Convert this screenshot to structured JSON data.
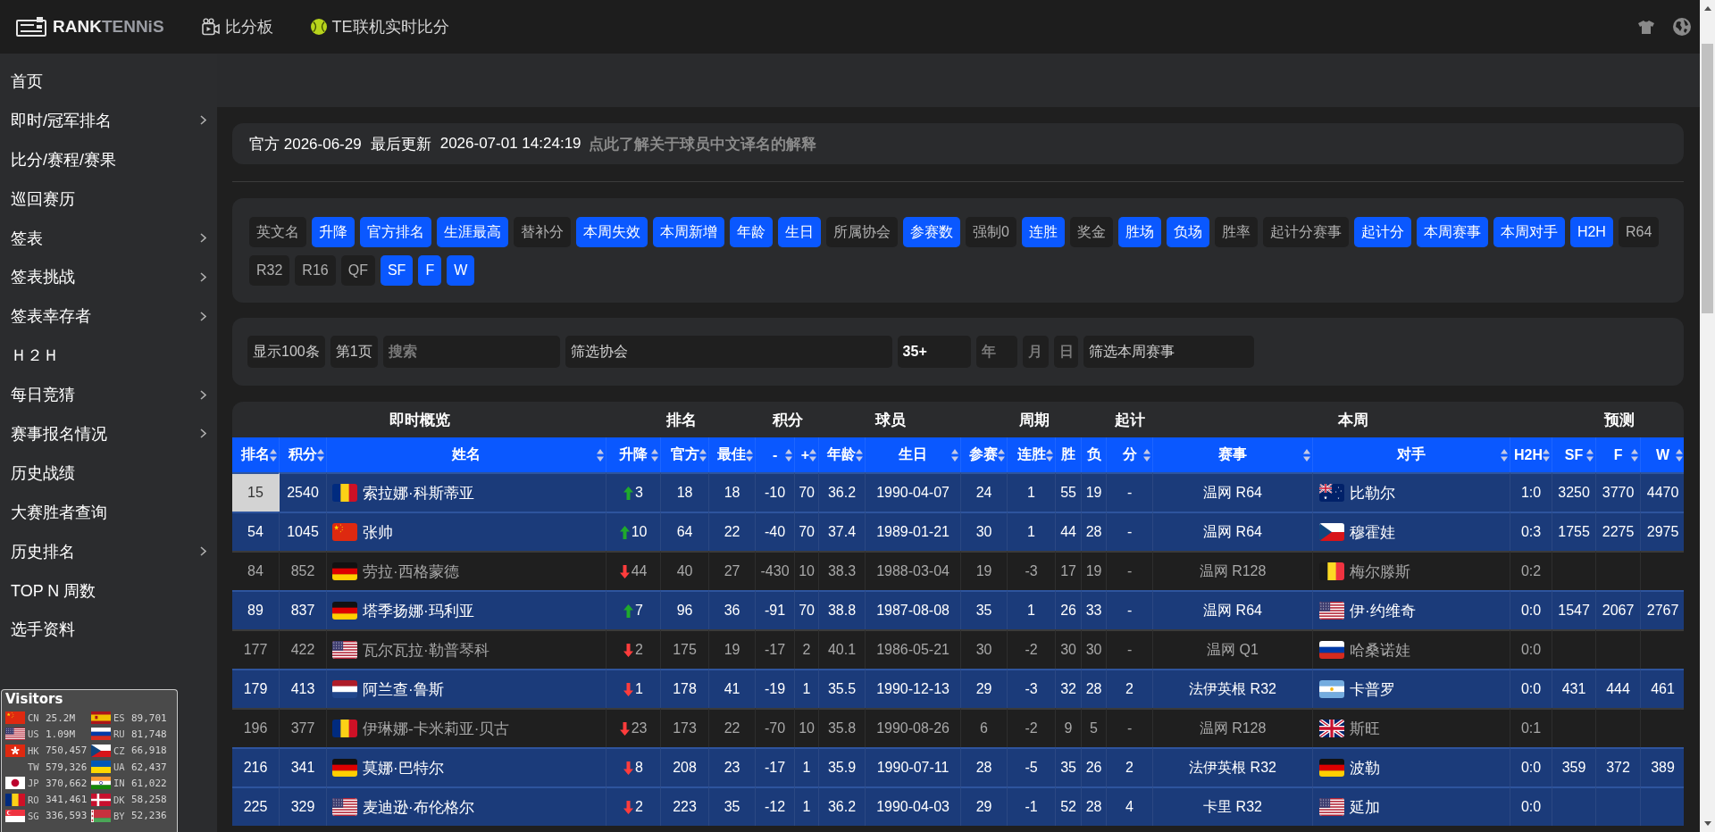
{
  "header": {
    "logo": {
      "strong": "RANK",
      "light": "TENNiS"
    },
    "nav": [
      {
        "kind": "video",
        "label": "比分板"
      },
      {
        "kind": "ball",
        "label": "TE联机实时比分"
      }
    ]
  },
  "sidebar": {
    "items": [
      {
        "label": "首页",
        "has_submenu": false
      },
      {
        "label": "即时/冠军排名",
        "has_submenu": true
      },
      {
        "label": "比分/赛程/赛果",
        "has_submenu": false
      },
      {
        "label": "巡回赛历",
        "has_submenu": false
      },
      {
        "label": "签表",
        "has_submenu": true
      },
      {
        "label": "签表挑战",
        "has_submenu": true
      },
      {
        "label": "签表幸存者",
        "has_submenu": true
      },
      {
        "label": "Ｈ２Ｈ",
        "has_submenu": false
      },
      {
        "label": "每日竞猜",
        "has_submenu": true
      },
      {
        "label": "赛事报名情况",
        "has_submenu": true
      },
      {
        "label": "历史战绩",
        "has_submenu": false
      },
      {
        "label": "大赛胜者查询",
        "has_submenu": false
      },
      {
        "label": "历史排名",
        "has_submenu": true
      },
      {
        "label": "TOP N 周数",
        "has_submenu": false
      },
      {
        "label": "选手资料",
        "has_submenu": false
      }
    ],
    "visitors": {
      "title": "Visitors",
      "entries": [
        {
          "flag": {
            "kind": "cn"
          },
          "code": "CN",
          "count": "25.2M"
        },
        {
          "flag": {
            "kind": "es"
          },
          "code": "ES",
          "count": "89,701"
        },
        {
          "flag": {
            "kind": "us"
          },
          "code": "US",
          "count": "1.09M"
        },
        {
          "flag": {
            "kind": "ru"
          },
          "code": "RU",
          "count": "81,748"
        },
        {
          "flag": {
            "kind": "hk"
          },
          "code": "HK",
          "count": "750,457"
        },
        {
          "flag": {
            "kind": "cz"
          },
          "code": "CZ",
          "count": "66,918"
        },
        {
          "code": "TW",
          "count": "579,326"
        },
        {
          "flag": {
            "kind": "ua"
          },
          "code": "UA",
          "count": "62,437"
        },
        {
          "flag": {
            "kind": "jp"
          },
          "code": "JP",
          "count": "370,662"
        },
        {
          "flag": {
            "kind": "in"
          },
          "code": "IN",
          "count": "61,022"
        },
        {
          "flag": {
            "kind": "ro"
          },
          "code": "RO",
          "count": "341,461"
        },
        {
          "flag": {
            "kind": "dk"
          },
          "code": "DK",
          "count": "58,258"
        },
        {
          "flag": {
            "kind": "sg"
          },
          "code": "SG",
          "count": "336,593"
        },
        {
          "flag": {
            "kind": "by"
          },
          "code": "BY",
          "count": "52,236"
        }
      ]
    }
  },
  "info": {
    "official": "官方 2026-06-29",
    "update_label": "最后更新",
    "update_time": "2026-07-01 14:24:19",
    "link": "点此了解关于球员中文译名的解释"
  },
  "column_toggles": [
    {
      "label": "英文名",
      "on": false
    },
    {
      "label": "升降",
      "on": true
    },
    {
      "label": "官方排名",
      "on": true
    },
    {
      "label": "生涯最高",
      "on": true
    },
    {
      "label": "替补分",
      "on": false
    },
    {
      "label": "本周失效",
      "on": true
    },
    {
      "label": "本周新增",
      "on": true
    },
    {
      "label": "年龄",
      "on": true
    },
    {
      "label": "生日",
      "on": true
    },
    {
      "label": "所属协会",
      "on": false
    },
    {
      "label": "参赛数",
      "on": true
    },
    {
      "label": "强制0",
      "on": false
    },
    {
      "label": "连胜",
      "on": true
    },
    {
      "label": "奖金",
      "on": false
    },
    {
      "label": "胜场",
      "on": true
    },
    {
      "label": "负场",
      "on": true
    },
    {
      "label": "胜率",
      "on": false
    },
    {
      "label": "起计分赛事",
      "on": false
    },
    {
      "label": "起计分",
      "on": true
    },
    {
      "label": "本周赛事",
      "on": true
    },
    {
      "label": "本周对手",
      "on": true
    },
    {
      "label": "H2H",
      "on": true
    },
    {
      "label": "R64",
      "on": false
    },
    {
      "label": "R32",
      "on": false
    },
    {
      "label": "R16",
      "on": false
    },
    {
      "label": "QF",
      "on": false
    },
    {
      "label": "SF",
      "on": true
    },
    {
      "label": "F",
      "on": true
    },
    {
      "label": "W",
      "on": true
    }
  ],
  "filters": [
    {
      "kind": "button",
      "label": "显示100条"
    },
    {
      "kind": "button",
      "label": "第1页"
    },
    {
      "kind": "input",
      "placeholder": "搜索"
    },
    {
      "kind": "select",
      "value": "筛选协会"
    },
    {
      "kind": "input",
      "value": "35+"
    },
    {
      "kind": "input",
      "placeholder": "年"
    },
    {
      "kind": "input",
      "placeholder": "月"
    },
    {
      "kind": "input",
      "placeholder": "日"
    },
    {
      "kind": "select",
      "value": "筛选本周赛事"
    }
  ],
  "table": {
    "groups": [
      {
        "label": "即时概览"
      },
      {
        "label": "排名"
      },
      {
        "label": "积分"
      },
      {
        "label": "球员"
      },
      {
        "label": "周期"
      },
      {
        "label": "起计"
      },
      {
        "label": "本周"
      },
      {
        "label": "预测"
      }
    ],
    "columns": [
      {
        "label": "排名",
        "sortable": true
      },
      {
        "label": "积分",
        "sortable": true
      },
      {
        "label": "姓名",
        "sortable": true
      },
      {
        "label": "升降",
        "sortable": true
      },
      {
        "label": "官方",
        "sortable": true
      },
      {
        "label": "最佳",
        "sortable": true
      },
      {
        "label": "-",
        "sortable": true
      },
      {
        "label": "+",
        "sortable": true
      },
      {
        "label": "年龄",
        "sortable": true
      },
      {
        "label": "生日",
        "sortable": true
      },
      {
        "label": "参赛",
        "sortable": true
      },
      {
        "label": "连胜",
        "sortable": true
      },
      {
        "label": "胜",
        "sortable": false
      },
      {
        "label": "负",
        "sortable": false
      },
      {
        "label": "分",
        "sortable": true
      },
      {
        "label": "赛事",
        "sortable": true
      },
      {
        "label": "对手",
        "sortable": true
      },
      {
        "label": "H2H",
        "sortable": true
      },
      {
        "label": "SF",
        "sortable": true
      },
      {
        "label": "F",
        "sortable": true
      },
      {
        "label": "W",
        "sortable": true
      }
    ],
    "rows": [
      {
        "highlighted": true,
        "rank_selected": true,
        "rank": "15",
        "points": "2540",
        "player": {
          "flag": {
            "kind": "ro"
          },
          "name": "索拉娜·科斯蒂亚"
        },
        "change": {
          "kind": "up",
          "value": "3"
        },
        "official": "18",
        "best": "18",
        "minus": "-10",
        "plus": "70",
        "age": "36.2",
        "birthday": "1990-04-07",
        "played": "24",
        "streak": "1",
        "wins": "55",
        "losses": "19",
        "since_points": "-",
        "event": "温网 R64",
        "opponent": {
          "flag": {
            "kind": "au"
          },
          "name": "比勒尔"
        },
        "h2h": "1:0",
        "sf": "3250",
        "f": "3770",
        "w": "4470"
      },
      {
        "highlighted": true,
        "rank_selected": false,
        "rank": "54",
        "points": "1045",
        "player": {
          "flag": {
            "kind": "cn"
          },
          "name": "张帅"
        },
        "change": {
          "kind": "up",
          "value": "10"
        },
        "official": "64",
        "best": "22",
        "minus": "-40",
        "plus": "70",
        "age": "37.4",
        "birthday": "1989-01-21",
        "played": "30",
        "streak": "1",
        "wins": "44",
        "losses": "28",
        "since_points": "-",
        "event": "温网 R64",
        "opponent": {
          "flag": {
            "kind": "cz"
          },
          "name": "穆霍娃"
        },
        "h2h": "0:3",
        "sf": "1755",
        "f": "2275",
        "w": "2975"
      },
      {
        "highlighted": false,
        "rank_selected": false,
        "rank": "84",
        "points": "852",
        "player": {
          "flag": {
            "kind": "de"
          },
          "name": "劳拉·西格蒙德"
        },
        "change": {
          "kind": "down",
          "value": "44"
        },
        "official": "40",
        "best": "27",
        "minus": "-430",
        "plus": "10",
        "age": "38.3",
        "birthday": "1988-03-04",
        "played": "19",
        "streak": "-3",
        "wins": "17",
        "losses": "19",
        "since_points": "-",
        "event": "温网 R128",
        "opponent": {
          "flag": {
            "kind": "be"
          },
          "name": "梅尔滕斯"
        },
        "h2h": "0:2"
      },
      {
        "highlighted": true,
        "rank_selected": false,
        "rank": "89",
        "points": "837",
        "player": {
          "flag": {
            "kind": "de"
          },
          "name": "塔季扬娜·玛利亚"
        },
        "change": {
          "kind": "up",
          "value": "7"
        },
        "official": "96",
        "best": "36",
        "minus": "-91",
        "plus": "70",
        "age": "38.8",
        "birthday": "1987-08-08",
        "played": "35",
        "streak": "1",
        "wins": "26",
        "losses": "33",
        "since_points": "-",
        "event": "温网 R64",
        "opponent": {
          "flag": {
            "kind": "us"
          },
          "name": "伊·约维奇"
        },
        "h2h": "0:0",
        "sf": "1547",
        "f": "2067",
        "w": "2767"
      },
      {
        "highlighted": false,
        "rank_selected": false,
        "rank": "177",
        "points": "422",
        "player": {
          "flag": {
            "kind": "us"
          },
          "name": "瓦尔瓦拉·勒普琴科"
        },
        "change": {
          "kind": "down",
          "value": "2"
        },
        "official": "175",
        "best": "19",
        "minus": "-17",
        "plus": "2",
        "age": "40.1",
        "birthday": "1986-05-21",
        "played": "30",
        "streak": "-2",
        "wins": "30",
        "losses": "30",
        "since_points": "-",
        "event": "温网 Q1",
        "opponent": {
          "flag": {
            "kind": "ru"
          },
          "name": "哈桑诺娃"
        },
        "h2h": "0:0"
      },
      {
        "highlighted": true,
        "rank_selected": false,
        "rank": "179",
        "points": "413",
        "player": {
          "flag": {
            "kind": "nl"
          },
          "name": "阿兰查·鲁斯"
        },
        "change": {
          "kind": "down",
          "value": "1"
        },
        "official": "178",
        "best": "41",
        "minus": "-19",
        "plus": "1",
        "age": "35.5",
        "birthday": "1990-12-13",
        "played": "29",
        "streak": "-3",
        "wins": "32",
        "losses": "28",
        "since_points": "2",
        "event": "法伊英根 R32",
        "opponent": {
          "flag": {
            "kind": "ar"
          },
          "name": "卡普罗"
        },
        "h2h": "0:0",
        "sf": "431",
        "f": "444",
        "w": "461"
      },
      {
        "highlighted": false,
        "rank_selected": false,
        "rank": "196",
        "points": "377",
        "player": {
          "flag": {
            "kind": "ro"
          },
          "name": "伊琳娜-卡米莉亚·贝古"
        },
        "change": {
          "kind": "down",
          "value": "23"
        },
        "official": "173",
        "best": "22",
        "minus": "-70",
        "plus": "10",
        "age": "35.8",
        "birthday": "1990-08-26",
        "played": "6",
        "streak": "-2",
        "wins": "9",
        "losses": "5",
        "since_points": "-",
        "event": "温网 R128",
        "opponent": {
          "flag": {
            "kind": "gb"
          },
          "name": "斯旺"
        },
        "h2h": "0:1"
      },
      {
        "highlighted": true,
        "rank_selected": false,
        "rank": "216",
        "points": "341",
        "player": {
          "flag": {
            "kind": "de"
          },
          "name": "莫娜·巴特尔"
        },
        "change": {
          "kind": "down",
          "value": "8"
        },
        "official": "208",
        "best": "23",
        "minus": "-17",
        "plus": "1",
        "age": "35.9",
        "birthday": "1990-07-11",
        "played": "28",
        "streak": "-5",
        "wins": "35",
        "losses": "26",
        "since_points": "2",
        "event": "法伊英根 R32",
        "opponent": {
          "flag": {
            "kind": "de"
          },
          "name": "波勒"
        },
        "h2h": "0:0",
        "sf": "359",
        "f": "372",
        "w": "389"
      },
      {
        "highlighted": true,
        "rank_selected": false,
        "rank": "225",
        "points": "329",
        "player": {
          "flag": {
            "kind": "us"
          },
          "name": "麦迪逊·布伦格尔"
        },
        "change": {
          "kind": "down",
          "value": "2"
        },
        "official": "223",
        "best": "35",
        "minus": "-12",
        "plus": "1",
        "age": "36.2",
        "birthday": "1990-04-03",
        "played": "29",
        "streak": "-1",
        "wins": "52",
        "losses": "28",
        "since_points": "4",
        "event": "卡里 R32",
        "opponent": {
          "flag": {
            "kind": "us"
          },
          "name": "延加"
        },
        "h2h": "0:0"
      }
    ]
  }
}
